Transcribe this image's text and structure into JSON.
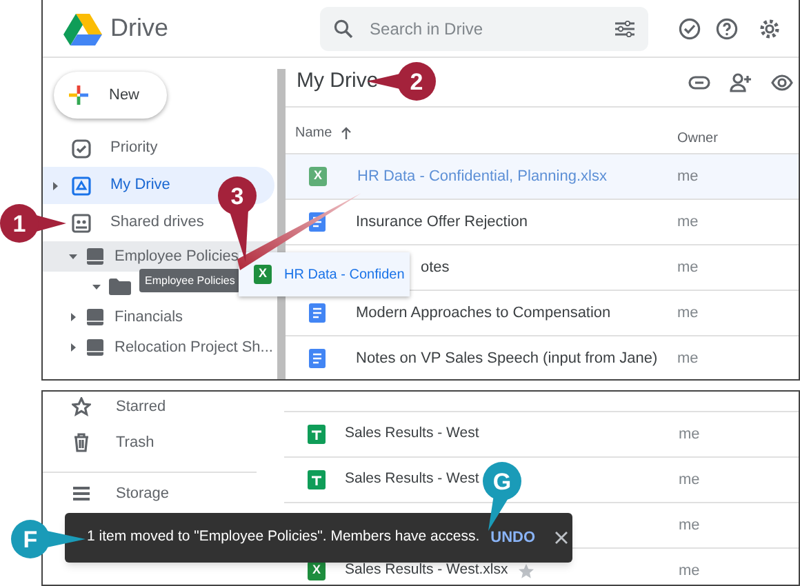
{
  "header": {
    "app_name": "Drive",
    "search": {
      "placeholder": "Search in Drive"
    }
  },
  "new_button": {
    "label": "New"
  },
  "sidebar": {
    "items": [
      {
        "label": "Priority",
        "selected": false
      },
      {
        "label": "My Drive",
        "selected": true,
        "expanded": false
      },
      {
        "label": "Shared drives",
        "selected": false,
        "children": [
          {
            "label": "Employee Policies",
            "drop_target": true,
            "expanded": true,
            "children": [
              {
                "expanded": true
              }
            ]
          },
          {
            "label": "Financials",
            "drop_target": false,
            "expanded": false
          },
          {
            "label": "Relocation Project Sh...",
            "drop_target": false,
            "expanded": false
          }
        ]
      }
    ]
  },
  "tooltip": {
    "text": "Employee Policies"
  },
  "drag_chip": {
    "icon_letter": "X",
    "label": "HR Data - Confiden"
  },
  "main": {
    "title": "My Drive",
    "columns": [
      "Name",
      "Owner"
    ],
    "rows": [
      {
        "kind": "xlsx",
        "icon_letter": "X",
        "name": "HR Data - Confidential, Planning.xlsx",
        "owner": "me",
        "dragging": true
      },
      {
        "kind": "doc",
        "name": "Insurance Offer Rejection",
        "owner": "me",
        "dragging": false
      },
      {
        "kind": "covered",
        "name": "otes",
        "owner": "me",
        "dragging": false
      },
      {
        "kind": "doc",
        "name": "Modern Approaches to Compensation",
        "owner": "me",
        "dragging": false
      },
      {
        "kind": "doc",
        "name": "Notes on VP Sales Speech (input from Jane)",
        "owner": "me",
        "dragging": false
      }
    ]
  },
  "lower": {
    "sidebar_items": [
      {
        "label": "Starred"
      },
      {
        "label": "Trash"
      },
      {
        "label": "Storage"
      }
    ],
    "rows": [
      {
        "kind": "sheet",
        "name": "Sales Results - West",
        "owner": "me",
        "star_shown": false
      },
      {
        "kind": "sheet",
        "name": "Sales Results - West",
        "owner": "me",
        "star_shown": false
      },
      {
        "kind": "covered",
        "owner": "me",
        "star_shown": false
      },
      {
        "kind": "xlsx",
        "icon_letter": "X",
        "name": "Sales Results - West.xlsx",
        "owner": "me",
        "star_shown": true
      }
    ]
  },
  "snackbar": {
    "message": "1 item moved to \"Employee Policies\". Members have access.",
    "action": "UNDO"
  },
  "callouts": [
    {
      "label": "1"
    },
    {
      "label": "2"
    },
    {
      "label": "3"
    },
    {
      "label": "F"
    },
    {
      "label": "G"
    }
  ]
}
